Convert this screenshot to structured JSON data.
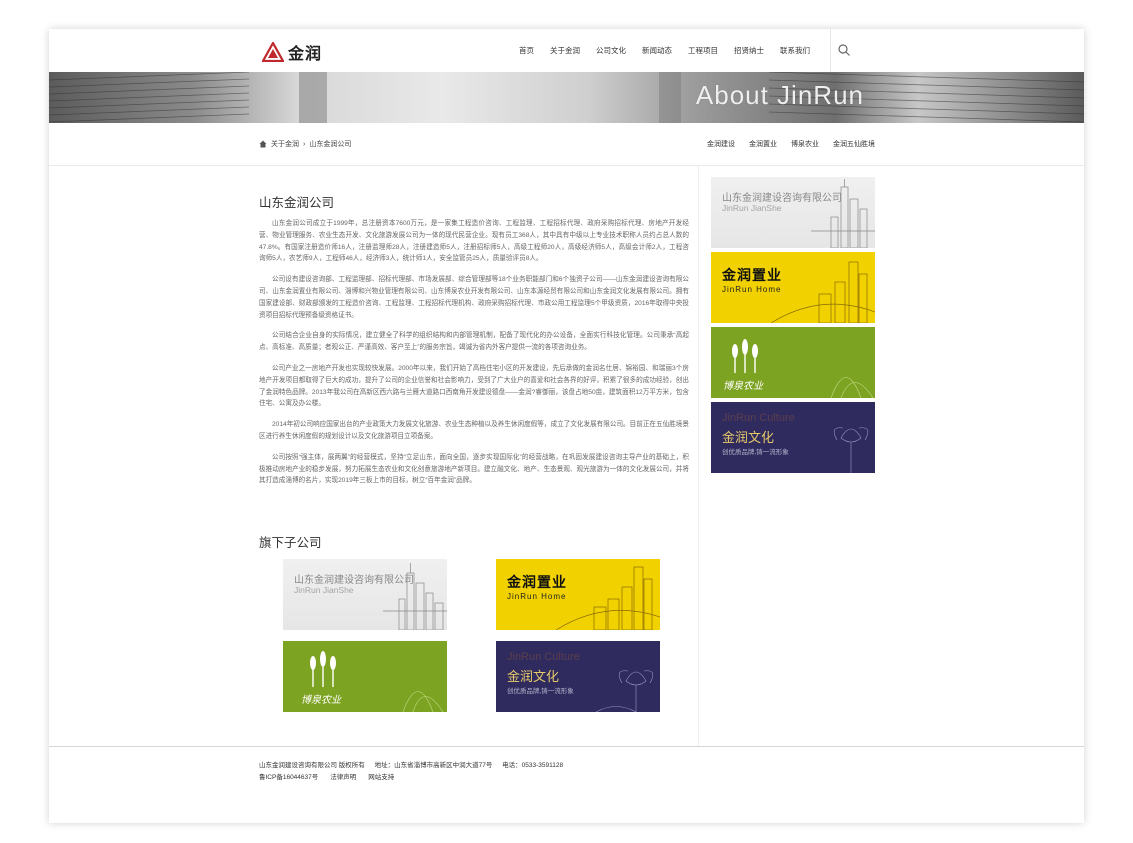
{
  "header": {
    "logo_text": "金润",
    "nav": [
      "首页",
      "关于金润",
      "公司文化",
      "新闻动态",
      "工程项目",
      "招贤纳士",
      "联系我们"
    ]
  },
  "banner": {
    "title": "About JinRun"
  },
  "breadcrumb": {
    "items": [
      "关于金润",
      "山东金润公司"
    ]
  },
  "subnav": [
    "金润建设",
    "金润置业",
    "博泉农业",
    "金润五仙胜境"
  ],
  "main": {
    "title": "山东金润公司",
    "paragraphs": [
      "山东金润公司成立于1999年，总注册资本7600万元，是一家集工程造价咨询、工程监理、工程招标代理、政府采购招标代理、房地产开发经营、物业管理服务、农业生态开发、文化旅游发展公司为一体的现代民营企业。现有员工368人，其中具有中级以上专业技术职称人员约占总人数的47.8%。有国家注册造价师16人，注册监理师28人，注册建造师5人，注册招标师5人，高级工程师20人，高级经济师5人，高级会计师2人，工程咨询师5人，农艺师9人，工程师46人，经济师3人，统计师1人，安全监管员25人，质量验评员8人。",
      "公司设有建设咨询部、工程监理部、招标代理部、市场发展部、综合管理部等18个业务职能部门和6个独资子公司——山东金润建设咨询有限公司、山东金润置业有限公司、淄博和兴物业管理有限公司、山东博泉农业开发有限公司、山东本源经贸有限公司和山东金润文化发展有限公司。拥有国家建设部、财政部颁发的工程造价咨询、工程监理、工程招标代理机构、政府采购招标代理、市政公用工程监理5个甲级资质，2016年取得中央投资项目招标代理预备级资格证书。",
      "公司结合企业自身的实际情况，建立健全了科学的组织结构和内部管理机制，配备了现代化的办公设备，全面实行科技化管理。公司秉承“高起点、高标准、高质量；者观公正、严谨高效、客户至上”的服务宗旨，竭诚为省内外客户提供一流的各项咨询业务。",
      "公司产业之一房地产开发也实现较快发展。2000年以来，我们开始了高档住宅小区的开发建设，先后承做的金润名仕居、锦裕园、和瑞丽3个房地产开发项目都取得了巨大的成功，提升了公司的企业信誉和社会影响力，受到了广大业户的喜爱和社会各界的好评，积累了很多的成功经验，创出了金润特色品牌。2013年我公司在高新区西六路与兰雁大道路口西南角开发建设德盘——金润?睿御丽，该盘占地50亩，建筑面积12万平方米，包含住宅、公寓及办公楼。",
      "2014年初公司响应国家出台的产业政策大力发展文化旅游、农业生态种植以及养生休闲度假等，成立了文化发展有限公司。目前正在五仙胜境景区进行养生休闲度假的规划设计以及文化旅游项目立项备案。",
      "公司按照“强主体，展两翼”的经营模式，坚持“立足山东，面向全国，逐步实现国际化”的经营战略，在巩固发展建设咨询主导产业的基础上，积极推动房地产业的稳步发展，努力拓展生态农业和文化创意旅游地产新项目。建立融文化、地产、生态景观、观光旅游为一体的文化发展公司，并将其打造成淄博的名片，实现2019年三板上市的目标，树立“百年金润”品牌。"
    ],
    "subsidiaries_title": "旗下子公司"
  },
  "cards": {
    "jianshe": {
      "cn": "山东金润建设咨询有限公司",
      "en": "JinRun JianShe"
    },
    "home": {
      "cn": "金润置业",
      "en": "JinRun Home"
    },
    "agri": {
      "cn": "博泉农业"
    },
    "culture": {
      "en": "JinRun Culture",
      "cn": "金润文化",
      "slogan": "创优质品牌,铸一流形象"
    }
  },
  "footer": {
    "copyright": "山东金润建设咨询有限公司 版权所有",
    "address": "地址：山东省淄博市高新区中润大道77号",
    "phone": "电话：0533-3591128",
    "icp": "鲁ICP备16044637号",
    "legal": "法律声明",
    "support": "网站支持"
  },
  "colors": {
    "home_yellow": "#f1d200",
    "agri_green": "#7da322",
    "culture_navy": "#2f2b5e",
    "culture_gold": "#e7c96a",
    "logo_red": "#c0282d"
  },
  "icons": [
    "logo-mark-icon",
    "search-icon",
    "home-icon",
    "wheat-icon",
    "city-skyline-icon",
    "lotus-icon"
  ]
}
